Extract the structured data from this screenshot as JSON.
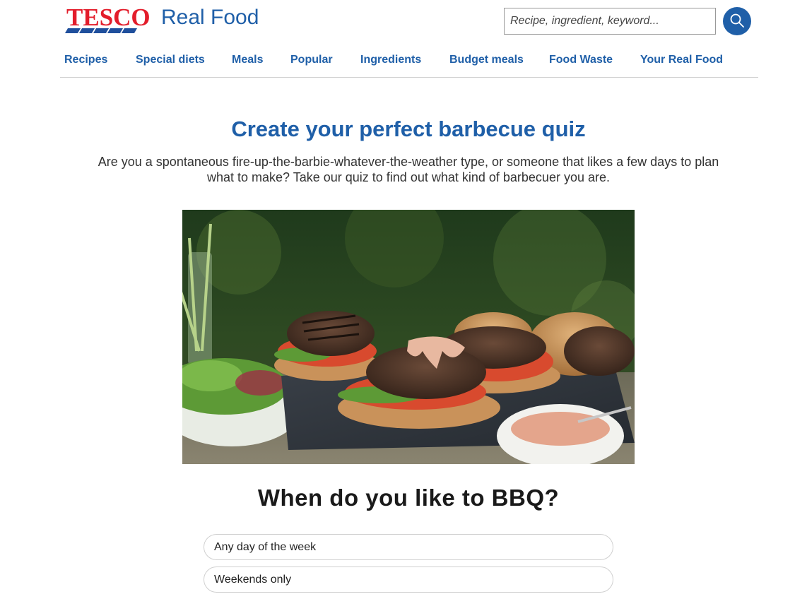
{
  "header": {
    "logo_brand": "TESCO",
    "logo_text": "Real Food",
    "search_placeholder": "Recipe, ingredient, keyword...",
    "search_icon": "search-icon"
  },
  "nav": {
    "items": [
      {
        "label": "Recipes"
      },
      {
        "label": "Special diets"
      },
      {
        "label": "Meals"
      },
      {
        "label": "Popular"
      },
      {
        "label": "Ingredients"
      },
      {
        "label": "Budget meals"
      },
      {
        "label": "Food Waste"
      },
      {
        "label": "Your Real Food"
      }
    ]
  },
  "main": {
    "title": "Create your perfect barbecue quiz",
    "intro": "Are you a spontaneous fire-up-the-barbie-whatever-the-weather type, or someone that likes a few days to plan what to make? Take our quiz to find out what kind of barbecuer you are.",
    "hero_image": "burgers-on-slate-photo",
    "question": "When do you like to BBQ?",
    "options": [
      {
        "label": "Any day of the week"
      },
      {
        "label": "Weekends only"
      }
    ]
  },
  "colors": {
    "brand_blue": "#1f5fa8",
    "brand_red": "#e31d2b",
    "logo_stripe_blue": "#1f4f9c"
  }
}
